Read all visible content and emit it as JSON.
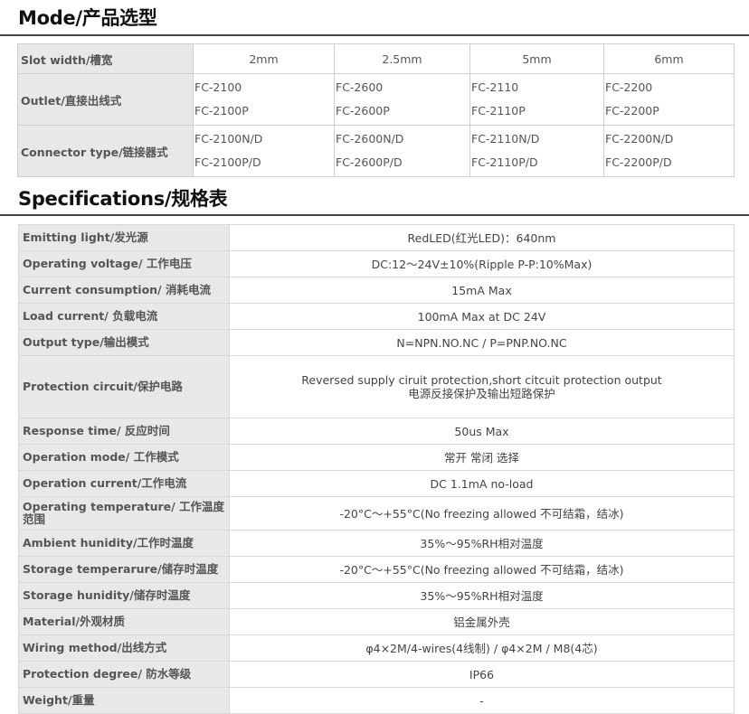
{
  "mode_section": {
    "title": "Mode/产品选型",
    "headers": [
      "Slot width/槽宽",
      "2mm",
      "2.5mm",
      "5mm",
      "6mm"
    ],
    "rows": [
      {
        "label": "Outlet/直接出线式",
        "cells": [
          [
            "FC-2100",
            "FC-2100P"
          ],
          [
            "FC-2600",
            "FC-2600P"
          ],
          [
            "FC-2110",
            "FC-2110P"
          ],
          [
            "FC-2200",
            "FC-2200P"
          ]
        ]
      },
      {
        "label": "Connector type/链接器式",
        "cells": [
          [
            "FC-2100N/D",
            "FC-2100P/D"
          ],
          [
            "FC-2600N/D",
            "FC-2600P/D"
          ],
          [
            "FC-2110N/D",
            "FC-2110P/D"
          ],
          [
            "FC-2200N/D",
            "FC-2200P/D"
          ]
        ]
      }
    ]
  },
  "spec_section": {
    "title": "Specifications/规格表",
    "rows": [
      {
        "label": "Emitting light/发光源",
        "value": "RedLED(红光LED)：640nm"
      },
      {
        "label": "Operating voltage/ 工作电压",
        "value": "DC:12～24V±10%(Ripple P-P:10%Max)"
      },
      {
        "label": "Current consumption/ 消耗电流",
        "value": "15mA Max"
      },
      {
        "label": "Load current/ 负载电流",
        "value": "100mA Max at DC 24V"
      },
      {
        "label": "Output type/输出模式",
        "value": "N=NPN.NO.NC / P=PNP.NO.NC"
      },
      {
        "label": "Protection circuit/保护电路",
        "value": "Reversed supply ciruit protection,short citcuit protection output",
        "value2": "电源反接保护及输出短路保护"
      },
      {
        "label": "Response time/ 反应时间",
        "value": "50us Max"
      },
      {
        "label": "Operation mode/ 工作模式",
        "value": "常开 常闭 选择"
      },
      {
        "label": "Operation current/工作电流",
        "value": "DC 1.1mA no-load"
      },
      {
        "label": "Operating temperature/ 工作温度范围",
        "value": "-20°C～+55°C(No freezing allowed 不可结霜，结冰)"
      },
      {
        "label": "Ambient hunidity/工作时温度",
        "value": "35%～95%RH相对温度"
      },
      {
        "label": "Storage temperarure/储存时温度",
        "value": "-20°C～+55°C(No freezing allowed 不可结霜，结冰)"
      },
      {
        "label": "Storage hunidity/储存时温度",
        "value": "35%～95%RH相对温度"
      },
      {
        "label": "Material/外观材质",
        "value": "铝金属外壳"
      },
      {
        "label": "Wiring method/出线方式",
        "value": "φ4×2M/4-wires(4线制) / φ4×2M / M8(4芯)"
      },
      {
        "label": "Protection degree/ 防水等级",
        "value": "IP66"
      },
      {
        "label": "Weight/重量",
        "value": "-"
      }
    ]
  }
}
